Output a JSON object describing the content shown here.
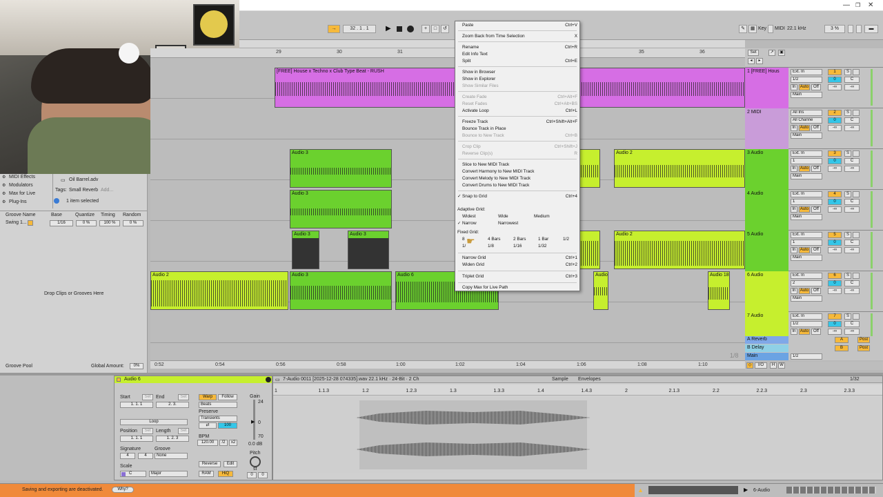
{
  "control_bar": {
    "position": "32 .  1 .  1",
    "key_label": "Key",
    "midi_label": "MIDI",
    "sample_rate": "22.1 kHz",
    "cpu": "3 %"
  },
  "browser": {
    "items": [
      "MIDI Effects",
      "Modulators",
      "Max for Live",
      "Plug-Ins"
    ],
    "file": "Oil Barrel.adv",
    "tags_label": "Tags:",
    "tag_value": "Small Reverb",
    "tag_add": "Add...",
    "selection_status": "1 item selected",
    "groove_headers": [
      "Groove Name",
      "Base",
      "Quantize",
      "Timing",
      "Random"
    ],
    "groove_row": [
      "Swing 1...",
      "1/16",
      "0 %",
      "100 %",
      "0 %"
    ],
    "drop_hint": "Drop Clips or Grooves Here",
    "groove_pool_label": "Groove Pool",
    "global_amount_label": "Global Amount:",
    "global_amount_value": "0%"
  },
  "ruler_top": [
    "29",
    "30",
    "31",
    "35",
    "36"
  ],
  "ruler_bottom": [
    "0:52",
    "0:54",
    "0:56",
    "0:58",
    "1:00",
    "1:02",
    "1:04",
    "1:06",
    "1:08",
    "1:10"
  ],
  "scroll_marker": "1/8",
  "clips": {
    "midi_clip": "[FREE] House x Techno x Club Type Beat - RUSH",
    "audio3": "Audio 3",
    "audio2": "Audio 2",
    "audio6": "Audio 6",
    "audio_short": "Audio",
    "audio18": "Audio 18"
  },
  "tracks": [
    {
      "name": "1 [FREE] Hous",
      "input": "Ext. In",
      "channel": "1/2",
      "num": "1",
      "color": "#d66ee4"
    },
    {
      "name": "2 MIDI",
      "input": "All Ins",
      "channel": "All Channe",
      "num": "2",
      "color": "#c99cd9"
    },
    {
      "name": "3 Audio",
      "input": "Ext. In",
      "channel": "1",
      "num": "3",
      "color": "#6bd12e"
    },
    {
      "name": "4 Audio",
      "input": "Ext. In",
      "channel": "1",
      "num": "4",
      "color": "#6bd12e"
    },
    {
      "name": "5 Audio",
      "input": "Ext. In",
      "channel": "1",
      "num": "5",
      "color": "#6bd12e"
    },
    {
      "name": "6 Audio",
      "input": "Ext. In",
      "channel": "2",
      "num": "6",
      "color": "#c6ef2e"
    },
    {
      "name": "7 Audio",
      "input": "Ext. In",
      "channel": "1/2",
      "num": "7",
      "color": "#c6ef2e"
    }
  ],
  "track_labels": {
    "monitor_in": "In",
    "monitor_auto": "Auto",
    "monitor_off": "Off",
    "out": "Main",
    "solo": "S",
    "vol": "0",
    "pan": "C",
    "inf": "-∞"
  },
  "returns": [
    {
      "name": "A Reverb",
      "letter": "A",
      "post": "Post"
    },
    {
      "name": "B Delay",
      "letter": "B",
      "post": "Post"
    },
    {
      "name": "Main",
      "letter": "",
      "post": "1/2"
    }
  ],
  "context_menu": [
    {
      "label": "Paste",
      "sc": "Ctrl+V",
      "dis": false
    },
    {
      "sep": true
    },
    {
      "label": "Zoom Back from Time Selection",
      "sc": "X",
      "dis": false
    },
    {
      "sep": true
    },
    {
      "label": "Rename",
      "sc": "Ctrl+R",
      "dis": false
    },
    {
      "label": "Edit Info Text",
      "sc": "",
      "dis": false
    },
    {
      "label": "Split",
      "sc": "Ctrl+E",
      "dis": false
    },
    {
      "sep": true
    },
    {
      "label": "Show in Browser",
      "sc": "",
      "dis": false
    },
    {
      "label": "Show in Explorer",
      "sc": "",
      "dis": false
    },
    {
      "label": "Show Similar Files",
      "sc": "",
      "dis": true
    },
    {
      "sep": true
    },
    {
      "label": "Create Fade",
      "sc": "Ctrl+Alt+F",
      "dis": true
    },
    {
      "label": "Reset Fades",
      "sc": "Ctrl+Alt+BS",
      "dis": true
    },
    {
      "label": "Activate Loop",
      "sc": "Ctrl+L",
      "dis": false
    },
    {
      "sep": true
    },
    {
      "label": "Freeze Track",
      "sc": "Ctrl+Shift+Alt+F",
      "dis": false
    },
    {
      "label": "Bounce Track in Place",
      "sc": "",
      "dis": false
    },
    {
      "label": "Bounce to New Track",
      "sc": "Ctrl+B",
      "dis": true
    },
    {
      "sep": true
    },
    {
      "label": "Crop Clip",
      "sc": "Ctrl+Shift+J",
      "dis": true
    },
    {
      "label": "Reverse Clip(s)",
      "sc": "R",
      "dis": true
    },
    {
      "sep": true
    },
    {
      "label": "Slice to New MIDI Track",
      "sc": "",
      "dis": false
    },
    {
      "label": "Convert Harmony to New MIDI Track",
      "sc": "",
      "dis": false
    },
    {
      "label": "Convert Melody to New MIDI Track",
      "sc": "",
      "dis": false
    },
    {
      "label": "Convert Drums to New MIDI Track",
      "sc": "",
      "dis": false
    },
    {
      "sep": true
    },
    {
      "label": "Snap to Grid",
      "sc": "Ctrl+4",
      "dis": false,
      "check": true
    }
  ],
  "context_grid": {
    "adaptive_label": "Adaptive Grid:",
    "adaptive": [
      "Widest",
      "Wide",
      "Medium",
      "Narrow",
      "Narrowest"
    ],
    "fixed_label": "Fixed Grid:",
    "fixed_row1": [
      "8",
      "4 Bars",
      "2 Bars",
      "1 Bar",
      "1/2"
    ],
    "fixed_row2": [
      "1/",
      "1/8",
      "1/16",
      "1/32"
    ],
    "narrow_grid": "Narrow Grid",
    "narrow_sc": "Ctrl+1",
    "widen_grid": "Widen Grid",
    "widen_sc": "Ctrl+2",
    "triplet_grid": "Triplet Grid",
    "triplet_sc": "Ctrl+3",
    "copy_max": "Copy Max for Live Path"
  },
  "clip_view": {
    "title": "Audio 6",
    "start_label": "Start",
    "end_label": "End",
    "set_label": "Set",
    "start_value": "1.   1.   1",
    "end_value": "2.   3.",
    "warp": "Warp",
    "follow": "Follow",
    "beats": "Beats",
    "preserve": "Preserve",
    "transients": "Transients",
    "loop": "Loop",
    "position_label": "Position",
    "length_label": "Length",
    "position_value": "1.   1.   1",
    "length_value": "1.   2.   3",
    "bpm_label": "BPM",
    "bpm_value": "120.00",
    "half": "/2",
    "double": "x2",
    "signature_label": "Signature",
    "sig_num": "4",
    "sig_den": "4",
    "groove_label": "Groove",
    "groove_value": "None",
    "scale_label": "Scale",
    "scale_root": "C",
    "scale_name": "Major",
    "gain_label": "Gain",
    "gain_top": "24",
    "gain_zero": "0",
    "gain_bottom": "70",
    "gain_value": "0.0 dB",
    "pitch_label": "Pitch",
    "pitch_st": "st",
    "pitch_value": "0",
    "pitch_cents": "0",
    "reverse": "Reverse",
    "edit": "Edit",
    "ram": "RAM",
    "hiq": "HiQ",
    "transpose": "100"
  },
  "sample_view": {
    "file_info": "7-Audio 0011 [2025-12-28 074335].wav  22.1 kHz · 24-Bit · 2 Ch",
    "tab_sample": "Sample",
    "tab_envelopes": "Envelopes",
    "zoom": "1/32",
    "ruler": [
      "1",
      "1.1.3",
      "1.2",
      "1.2.3",
      "1.3",
      "1.3.3",
      "1.4",
      "1.4.3",
      "2",
      "2.1.3",
      "2.2",
      "2.2.3",
      "2.3",
      "2.3.3"
    ]
  },
  "status": {
    "message": "Saving and exporting are deactivated.",
    "why": "Why?",
    "track_label": "6-Audio"
  }
}
